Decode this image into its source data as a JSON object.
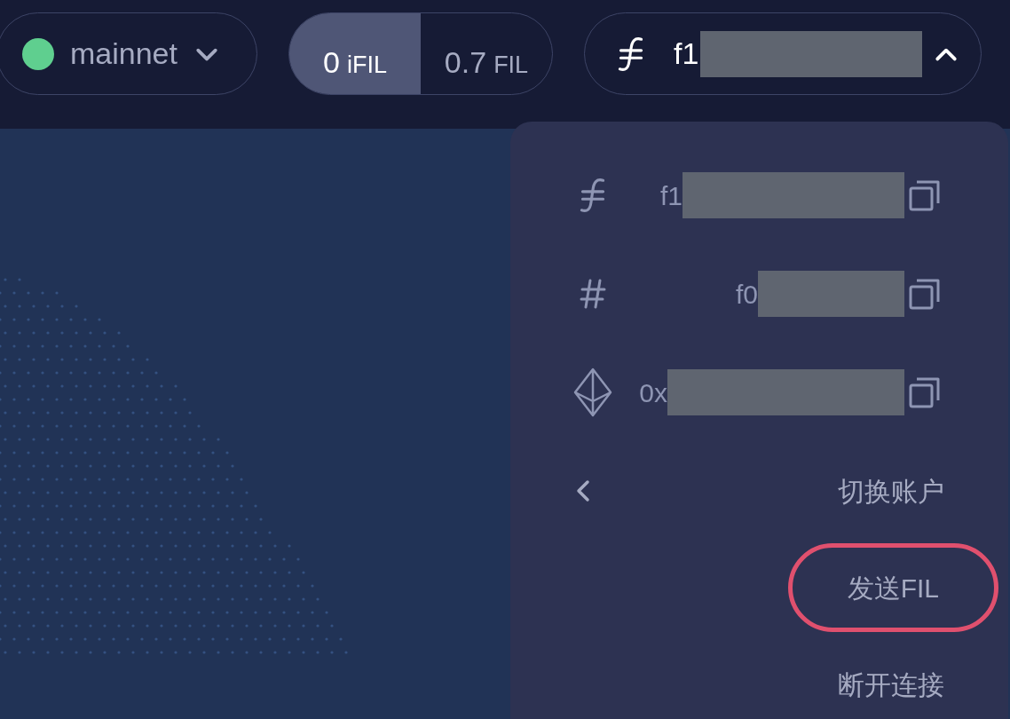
{
  "network": {
    "name": "mainnet",
    "connected": true
  },
  "balances": [
    {
      "amount": "0",
      "unit": "iFIL",
      "selected": true
    },
    {
      "amount": "0.7",
      "unit": "FIL",
      "selected": false
    }
  ],
  "account": {
    "address": "f1",
    "expanded": true
  },
  "menu": {
    "addresses": [
      {
        "kind": "filecoin",
        "text": "f1"
      },
      {
        "kind": "id",
        "text": "f0"
      },
      {
        "kind": "ethereum",
        "text": "0x"
      }
    ],
    "actions": [
      {
        "kind": "back",
        "label": "切换账户",
        "highlighted": false
      },
      {
        "kind": "plain",
        "label": "发送FIL",
        "highlighted": true
      },
      {
        "kind": "plain",
        "label": "断开连接",
        "highlighted": false
      }
    ]
  }
}
